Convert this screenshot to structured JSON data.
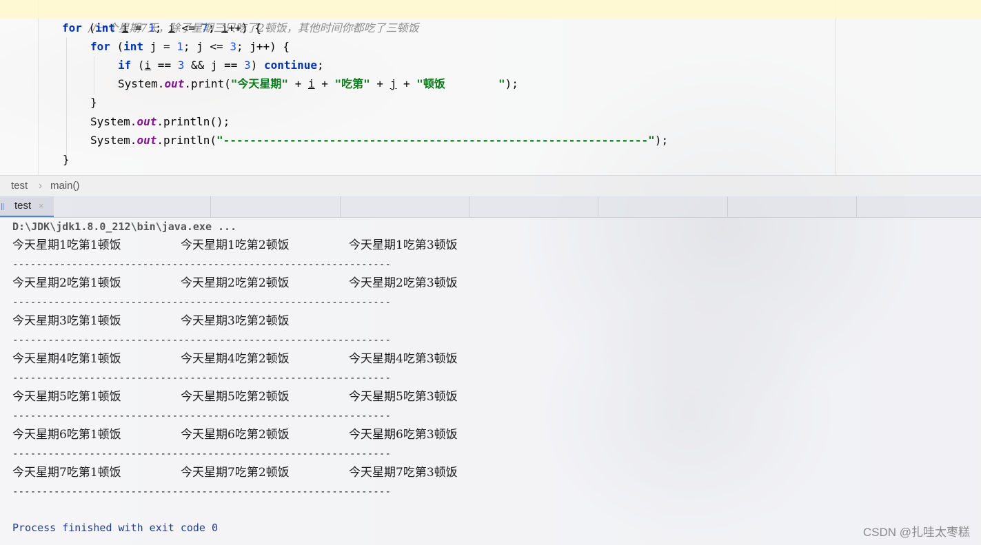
{
  "editor": {
    "comment": "//一个星期7天，除了星期三只吃了2顿饭，其他时间你都吃了三顿饭",
    "lines": {
      "for_outer_kw": "for",
      "for_outer_a": " (",
      "int1": "int",
      "for_outer_b": " ",
      "i1": "i",
      "for_outer_c": " = ",
      "one1": "1",
      "for_outer_d": "; ",
      "i2": "i",
      "for_outer_e": " <= ",
      "seven": "7",
      "for_outer_f": "; ",
      "i3": "i",
      "for_outer_g": "++) {",
      "for_inner_kw": "for",
      "for_inner_a": " (",
      "int2": "int",
      "for_inner_b": " j = ",
      "one2": "1",
      "for_inner_c": "; j <= ",
      "three1": "3",
      "for_inner_d": "; j++) {",
      "if_kw": "if",
      "if_a": " (",
      "i4": "i",
      "if_b": " == ",
      "three2": "3",
      "if_c": " && j == ",
      "three3": "3",
      "if_d": ") ",
      "continue_kw": "continue",
      "if_e": ";",
      "print_a": "System.",
      "out1": "out",
      "print_b": ".print(",
      "str1": "\"今天星期\"",
      "print_c": " + ",
      "i5": "i",
      "print_d": " + ",
      "str2": "\"吃第\"",
      "print_e": " + ",
      "j1": "j",
      "print_f": " + ",
      "str3": "\"顿饭        \"",
      "print_g": ");",
      "close_inner": "}",
      "println1_a": "System.",
      "out2": "out",
      "println1_b": ".println();",
      "println2_a": "System.",
      "out3": "out",
      "println2_b": ".println(",
      "dash_str": "\"----------------------------------------------------------------\"",
      "println2_c": ");",
      "close_outer": "}"
    }
  },
  "breadcrumb": {
    "class_name": "test",
    "separator": "›",
    "method": "main()"
  },
  "run_panel": {
    "tab_label": "test",
    "tab_close": "×"
  },
  "console": {
    "command": "D:\\JDK\\jdk1.8.0_212\\bin\\java.exe ...",
    "rows": [
      [
        "今天星期1吃第1顿饭",
        "今天星期1吃第2顿饭",
        "今天星期1吃第3顿饭"
      ],
      [
        "今天星期2吃第1顿饭",
        "今天星期2吃第2顿饭",
        "今天星期2吃第3顿饭"
      ],
      [
        "今天星期3吃第1顿饭",
        "今天星期3吃第2顿饭",
        ""
      ],
      [
        "今天星期4吃第1顿饭",
        "今天星期4吃第2顿饭",
        "今天星期4吃第3顿饭"
      ],
      [
        "今天星期5吃第1顿饭",
        "今天星期5吃第2顿饭",
        "今天星期5吃第3顿饭"
      ],
      [
        "今天星期6吃第1顿饭",
        "今天星期6吃第2顿饭",
        "今天星期6吃第3顿饭"
      ],
      [
        "今天星期7吃第1顿饭",
        "今天星期7吃第2顿饭",
        "今天星期7吃第3顿饭"
      ]
    ],
    "separator": "----------------------------------------------------------------",
    "finished": "Process finished with exit code 0"
  },
  "watermark": "CSDN @扎哇太枣糕",
  "colors": {
    "keyword": "#0033b3",
    "string": "#067d17",
    "number": "#1750eb",
    "field": "#871094",
    "comment": "#8c8c8c"
  }
}
